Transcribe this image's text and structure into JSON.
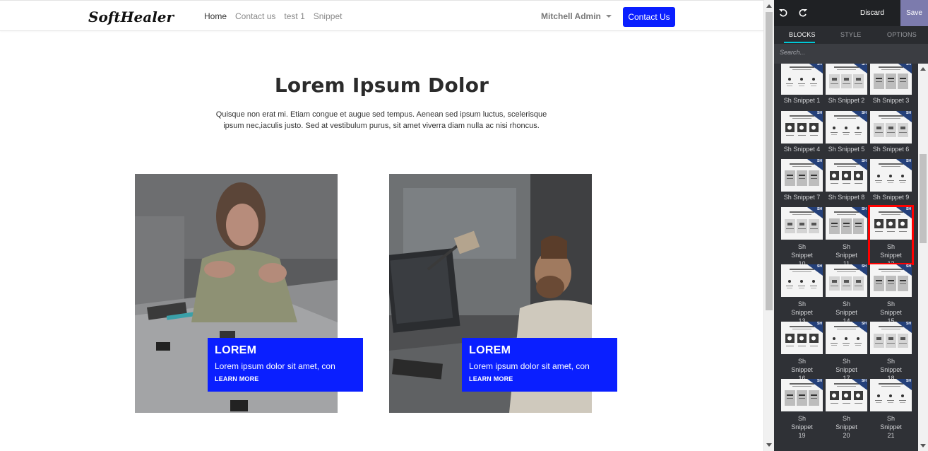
{
  "navbar": {
    "logo_text": "SoftHealer",
    "links": [
      {
        "label": "Home",
        "active": true
      },
      {
        "label": "Contact us",
        "active": false
      },
      {
        "label": "test 1",
        "active": false
      },
      {
        "label": "Snippet",
        "active": false
      }
    ],
    "user": "Mitchell Admin",
    "cta": "Contact Us"
  },
  "hero": {
    "title": "Lorem Ipsum Dolor",
    "text": "Quisque non erat mi. Etiam congue et augue sed tempus. Aenean sed ipsum luctus, scelerisque ipsum nec,iaculis justo. Sed at vestibulum purus, sit amet viverra diam nulla ac nisi rhoncus."
  },
  "cards": [
    {
      "title": "LOREM",
      "text": "Lorem ipsum dolor sit amet, con",
      "link": "LEARN MORE"
    },
    {
      "title": "LOREM",
      "text": "Lorem ipsum dolor sit amet, con",
      "link": "LEARN MORE"
    }
  ],
  "editor": {
    "discard": "Discard",
    "save": "Save",
    "tabs": [
      "BLOCKS",
      "STYLE",
      "OPTIONS"
    ],
    "search_placeholder": "Search...",
    "badge": "SH",
    "selected_block": "Sh Snippet 12",
    "blocks": [
      "Sh Snippet 1",
      "Sh Snippet 2",
      "Sh Snippet 3",
      "Sh Snippet 4",
      "Sh Snippet 5",
      "Sh Snippet 6",
      "Sh Snippet 7",
      "Sh Snippet 8",
      "Sh Snippet 9",
      "Sh Snippet 10",
      "Sh Snippet 11",
      "Sh Snippet 12",
      "Sh Snippet 13",
      "Sh Snippet 14",
      "Sh Snippet 15",
      "Sh Snippet 16",
      "Sh Snippet 17",
      "Sh Snippet 18",
      "Sh Snippet 19",
      "Sh Snippet 20",
      "Sh Snippet 21"
    ]
  },
  "colors": {
    "primary": "#0a1fff",
    "panel_bg": "#2f3136",
    "save_bg": "#7c7bad",
    "selection": "#ff0000",
    "tab_accent": "#00c8d7"
  }
}
